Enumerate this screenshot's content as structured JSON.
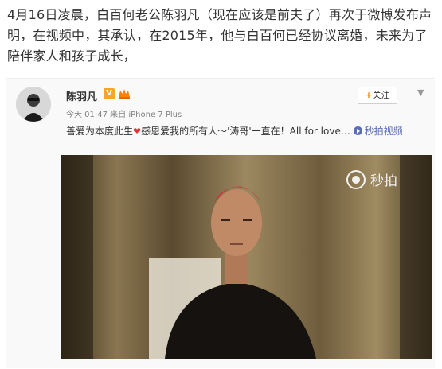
{
  "article": {
    "text": "4月16日凌晨，白百何老公陈羽凡（现在应该是前夫了）再次于微博发布声明，在视频中，其承认，在2015年，他与白百何已经协议离婚，未来为了陪伴家人和孩子成长，"
  },
  "post": {
    "user_name": "陈羽凡",
    "verified_badge": "V",
    "follow_label": "关注",
    "follow_plus": "+",
    "collapse_icon": "chevron-down-icon",
    "meta": "今天 01:47 来自 iPhone 7 Plus",
    "text_before_heart": "善爱为本度此生",
    "heart": "❤",
    "text_after_heart": "感恩爱我的所有人～'涛哥'一直在！All for love… ",
    "video_link": "秒拍视频",
    "watermark": "秒拍"
  },
  "colors": {
    "link": "#5b6eb4",
    "follow_plus": "#ff8200",
    "verified": "#f6a623",
    "heart": "#e0333a"
  }
}
